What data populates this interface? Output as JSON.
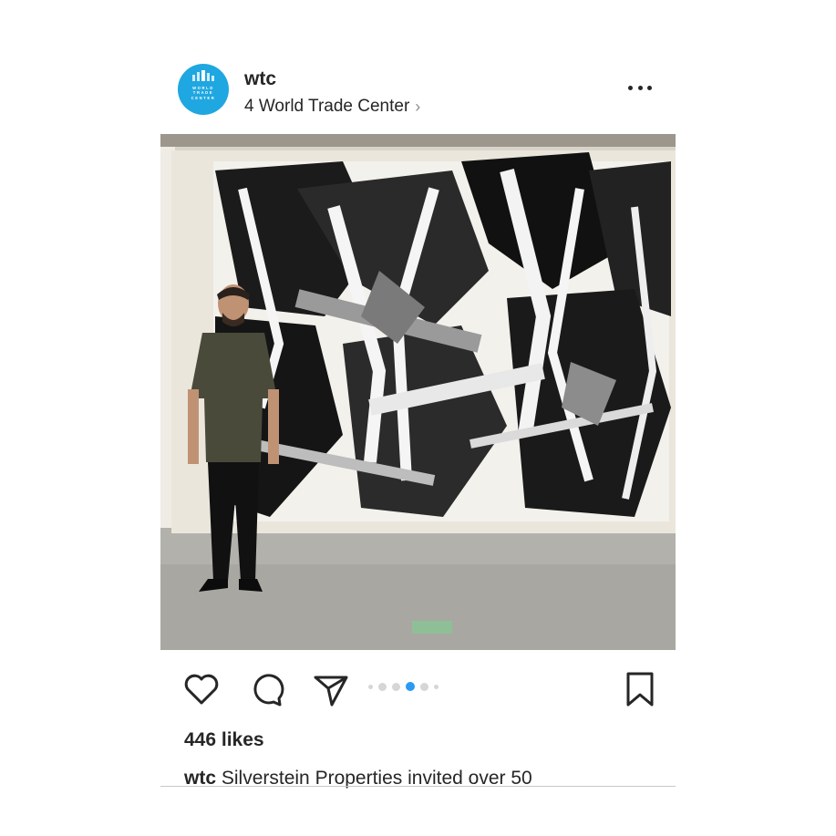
{
  "post": {
    "username": "wtc",
    "location": "4 World Trade Center",
    "avatar": {
      "lines": [
        "WORLD",
        "TRADE",
        "CENTER"
      ],
      "color": "#1fa7e1"
    },
    "more_icon": "ellipsis-icon",
    "photo_alt": "",
    "carousel": {
      "total": 6,
      "active_index": 3,
      "active_color": "#2b9af3"
    },
    "likes": "446 likes",
    "caption_user": "wtc",
    "caption_text": "Silverstein Properties invited over 50"
  },
  "actions": {
    "like_icon": "heart-icon",
    "comment_icon": "comment-icon",
    "share_icon": "send-icon",
    "save_icon": "bookmark-icon"
  }
}
